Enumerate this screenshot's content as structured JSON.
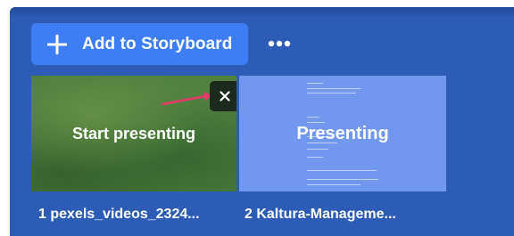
{
  "toolbar": {
    "add_label": "Add to Storyboard"
  },
  "thumbnails": [
    {
      "overlay_text": "Start presenting",
      "caption": "1 pexels_videos_2324..."
    },
    {
      "overlay_text": "Presenting",
      "caption": "2 Kaltura-Manageme..."
    }
  ],
  "colors": {
    "panel_bg": "#2c5cb5",
    "button_bg": "#3d7df5",
    "thumb2_bg": "#7297ef",
    "arrow": "#e83a6b"
  },
  "icons": [
    "plus-icon",
    "more-icon",
    "close-icon",
    "arrow-icon"
  ]
}
